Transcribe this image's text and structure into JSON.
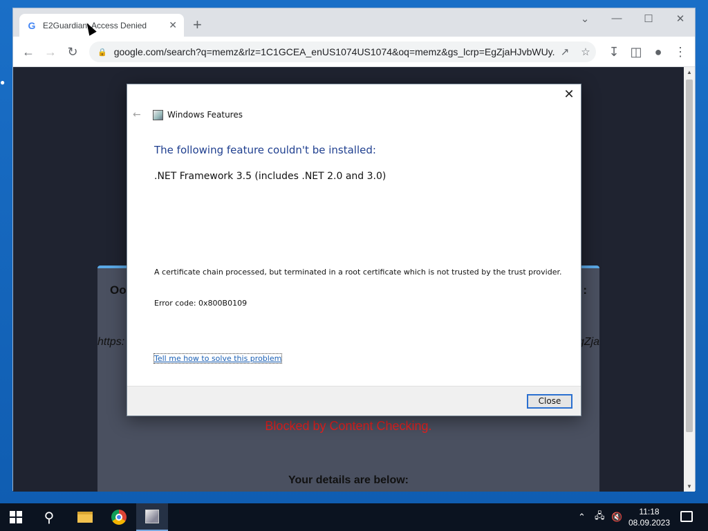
{
  "browser": {
    "tab_title": "E2Guardian: Access Denied",
    "favicon_letter": "G",
    "url": "google.com/search?q=memz&rlz=1C1GCEA_enUS1074US1074&oq=memz&gs_lcrp=EgZjaHJvbWUy..."
  },
  "page": {
    "oops_fragment": "Oo",
    "colon_fragment": ":",
    "url_fragment_left": "https:",
    "url_fragment_right": "gZja",
    "blocked_text": "Blocked by Content Checking.",
    "details_heading": "Your details are below:"
  },
  "dialog": {
    "title": "Windows Features",
    "heading": "The following feature couldn't be installed:",
    "feature": ".NET Framework 3.5 (includes .NET 2.0 and 3.0)",
    "message": "A certificate chain processed, but terminated in a root certificate which is not trusted by the trust provider.",
    "error_code": "Error code: 0x800B0109",
    "help_link": "Tell me how to solve this problem",
    "close_button": "Close"
  },
  "taskbar": {
    "time": "11:18",
    "date": "08.09.2023"
  }
}
